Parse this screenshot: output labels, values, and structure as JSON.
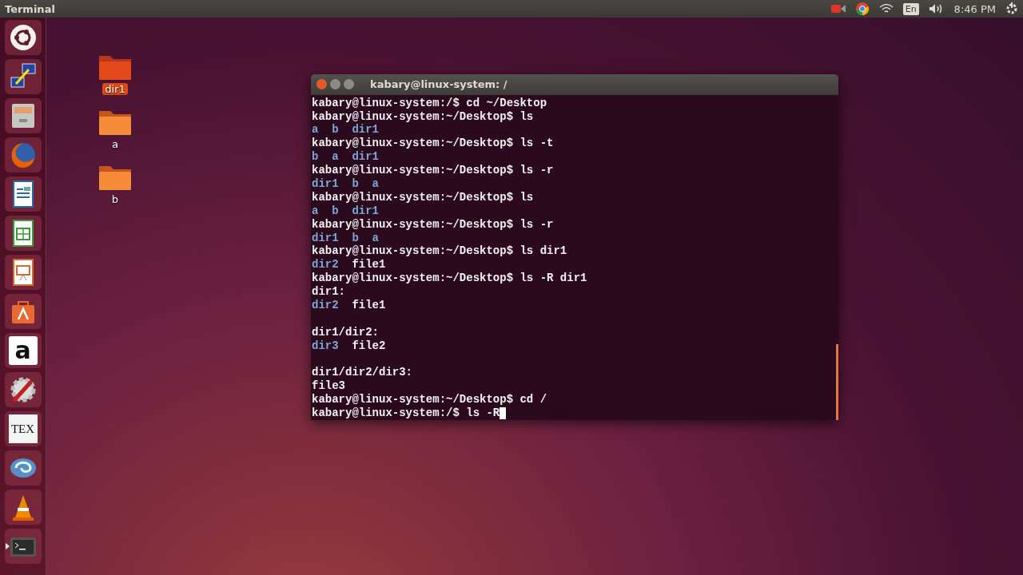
{
  "top_bar": {
    "title": "Terminal",
    "keyboard": "En",
    "clock": "8:46 PM"
  },
  "launcher": [
    {
      "kind": "ubuntu",
      "selected": false
    },
    {
      "kind": "network"
    },
    {
      "kind": "files"
    },
    {
      "kind": "firefox"
    },
    {
      "kind": "writer"
    },
    {
      "kind": "calc"
    },
    {
      "kind": "impress"
    },
    {
      "kind": "store"
    },
    {
      "kind": "amazon",
      "glyph": "a"
    },
    {
      "kind": "settings"
    },
    {
      "kind": "tex",
      "glyph": "TEX"
    },
    {
      "kind": "swirl"
    },
    {
      "kind": "vlc"
    },
    {
      "kind": "terminal",
      "running": true
    }
  ],
  "desktop_icons": [
    {
      "label": "dir1",
      "selected": true
    },
    {
      "label": "a",
      "selected": false
    },
    {
      "label": "b",
      "selected": false
    }
  ],
  "terminal": {
    "title": "kabary@linux-system: /",
    "lines": [
      {
        "kind": "prompt",
        "text": "kabary@linux-system:/$ cd ~/Desktop"
      },
      {
        "kind": "prompt",
        "text": "kabary@linux-system:~/Desktop$ ls"
      },
      {
        "kind": "listing",
        "items": [
          {
            "text": "a",
            "kind": "dir"
          },
          {
            "text": "b",
            "kind": "dir"
          },
          {
            "text": "dir1",
            "kind": "dir"
          }
        ]
      },
      {
        "kind": "prompt",
        "text": "kabary@linux-system:~/Desktop$ ls -t"
      },
      {
        "kind": "listing",
        "items": [
          {
            "text": "b",
            "kind": "dir"
          },
          {
            "text": "a",
            "kind": "dir"
          },
          {
            "text": "dir1",
            "kind": "dir"
          }
        ]
      },
      {
        "kind": "prompt",
        "text": "kabary@linux-system:~/Desktop$ ls -r"
      },
      {
        "kind": "listing",
        "items": [
          {
            "text": "dir1",
            "kind": "dir"
          },
          {
            "text": "b",
            "kind": "dir"
          },
          {
            "text": "a",
            "kind": "dir"
          }
        ]
      },
      {
        "kind": "prompt",
        "text": "kabary@linux-system:~/Desktop$ ls"
      },
      {
        "kind": "listing",
        "items": [
          {
            "text": "a",
            "kind": "dir"
          },
          {
            "text": "b",
            "kind": "dir"
          },
          {
            "text": "dir1",
            "kind": "dir"
          }
        ]
      },
      {
        "kind": "prompt",
        "text": "kabary@linux-system:~/Desktop$ ls -r"
      },
      {
        "kind": "listing",
        "items": [
          {
            "text": "dir1",
            "kind": "dir"
          },
          {
            "text": "b",
            "kind": "dir"
          },
          {
            "text": "a",
            "kind": "dir"
          }
        ]
      },
      {
        "kind": "prompt",
        "text": "kabary@linux-system:~/Desktop$ ls dir1"
      },
      {
        "kind": "listing",
        "items": [
          {
            "text": "dir2",
            "kind": "dir"
          },
          {
            "text": "file1",
            "kind": "file"
          }
        ]
      },
      {
        "kind": "prompt",
        "text": "kabary@linux-system:~/Desktop$ ls -R dir1"
      },
      {
        "kind": "plain",
        "text": "dir1:"
      },
      {
        "kind": "listing",
        "items": [
          {
            "text": "dir2",
            "kind": "dir"
          },
          {
            "text": "file1",
            "kind": "file"
          }
        ]
      },
      {
        "kind": "blank"
      },
      {
        "kind": "plain",
        "text": "dir1/dir2:"
      },
      {
        "kind": "listing",
        "items": [
          {
            "text": "dir3",
            "kind": "dir"
          },
          {
            "text": "file2",
            "kind": "file"
          }
        ]
      },
      {
        "kind": "blank"
      },
      {
        "kind": "plain",
        "text": "dir1/dir2/dir3:"
      },
      {
        "kind": "listing",
        "items": [
          {
            "text": "file3",
            "kind": "file"
          }
        ]
      },
      {
        "kind": "prompt",
        "text": "kabary@linux-system:~/Desktop$ cd /"
      },
      {
        "kind": "prompt",
        "text": "kabary@linux-system:/$ ls -R",
        "cursor": true
      }
    ]
  }
}
